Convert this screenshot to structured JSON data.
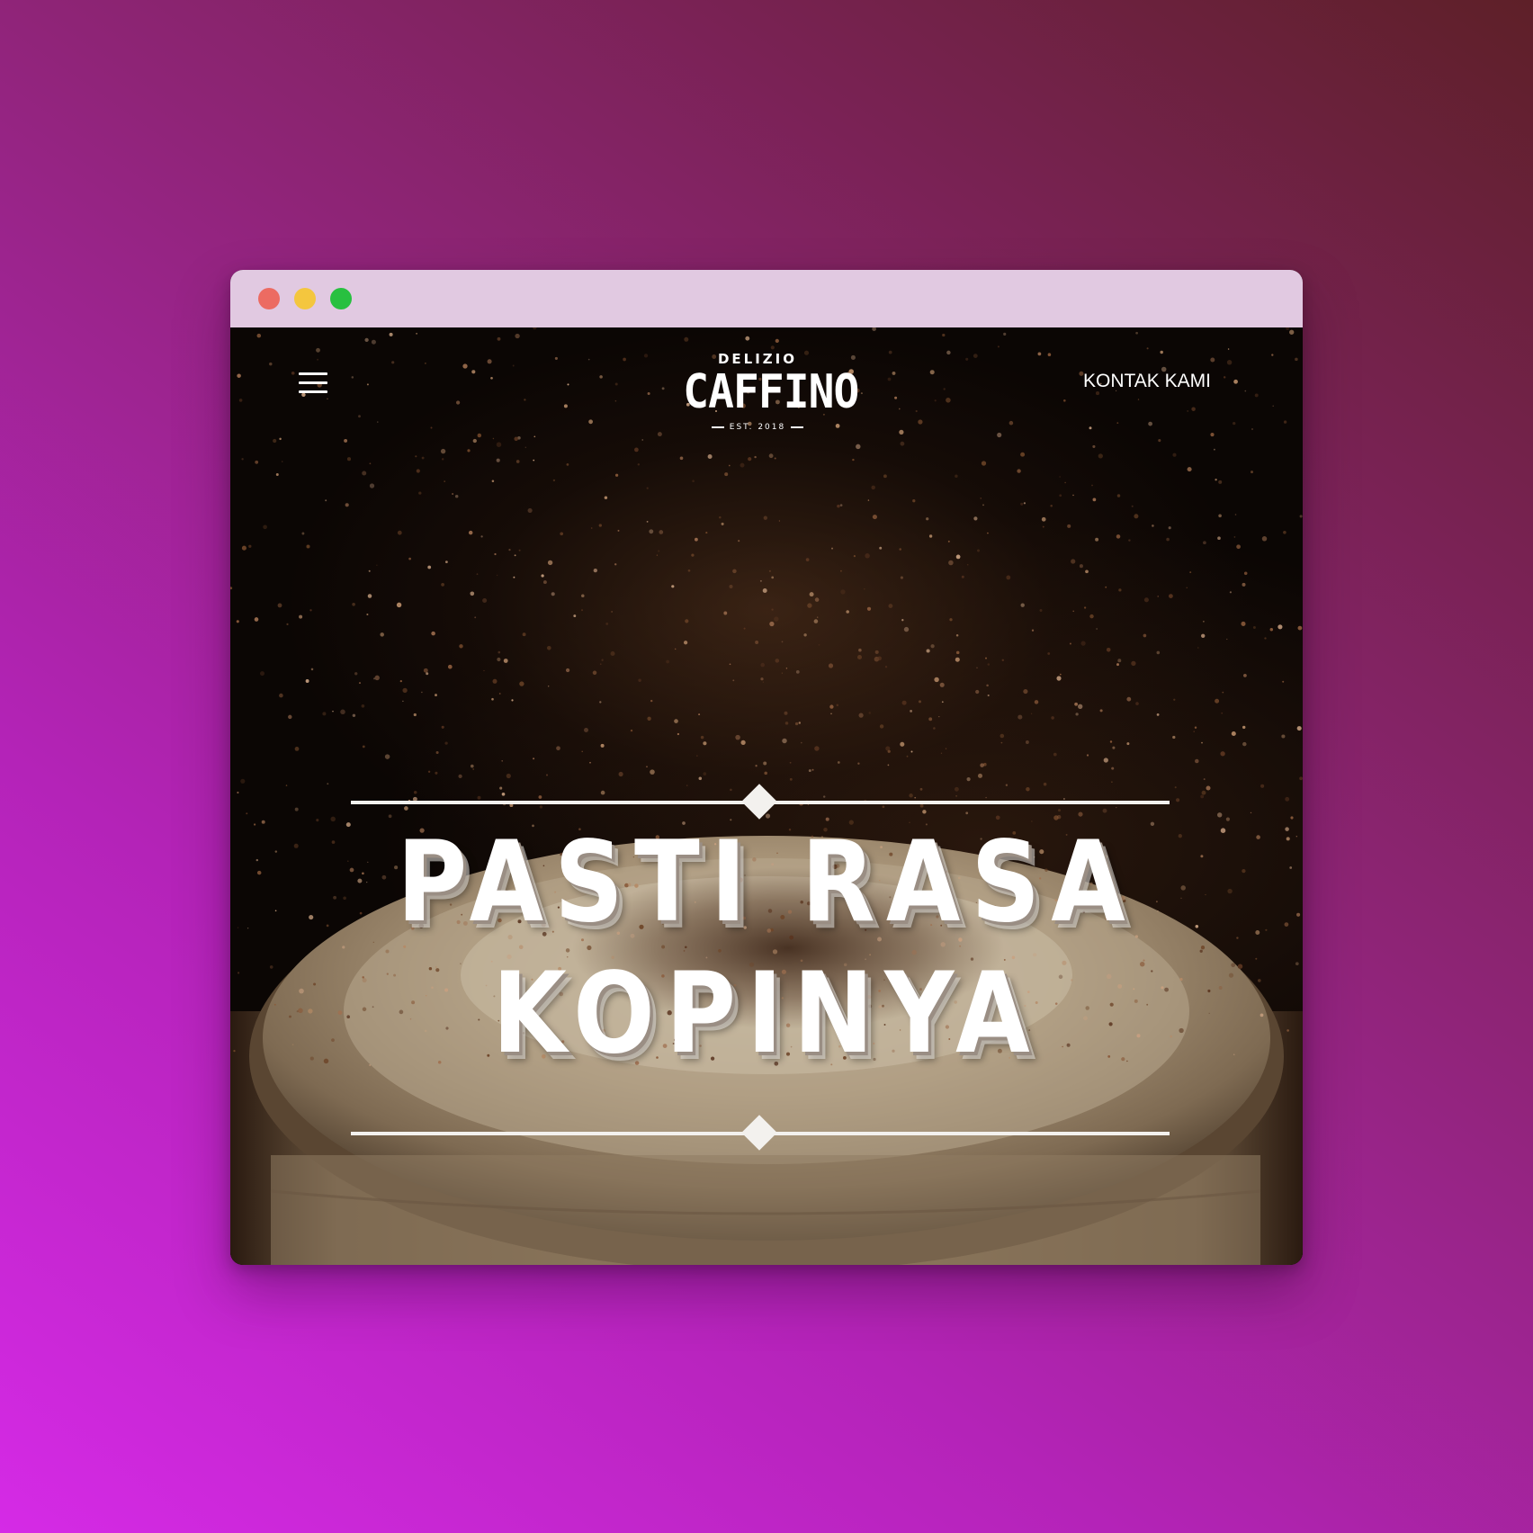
{
  "window": {
    "controls": [
      "close",
      "minimize",
      "maximize"
    ]
  },
  "nav": {
    "menu_icon": "hamburger-menu-icon",
    "contact_label": "KONTAK KAMI"
  },
  "logo": {
    "top_text": "DELIZIO",
    "main_text": "CAFFINO",
    "est_text": "EST. 2018"
  },
  "hero": {
    "line1": "PASTI RASA",
    "line2": "KOPINYA",
    "background": "coffee-cup-with-cocoa-powder"
  },
  "colors": {
    "titlebar": "#e1c9e1",
    "close": "#ec6b62",
    "minimize": "#f4c63e",
    "maximize": "#28c040",
    "text": "#ffffff"
  }
}
